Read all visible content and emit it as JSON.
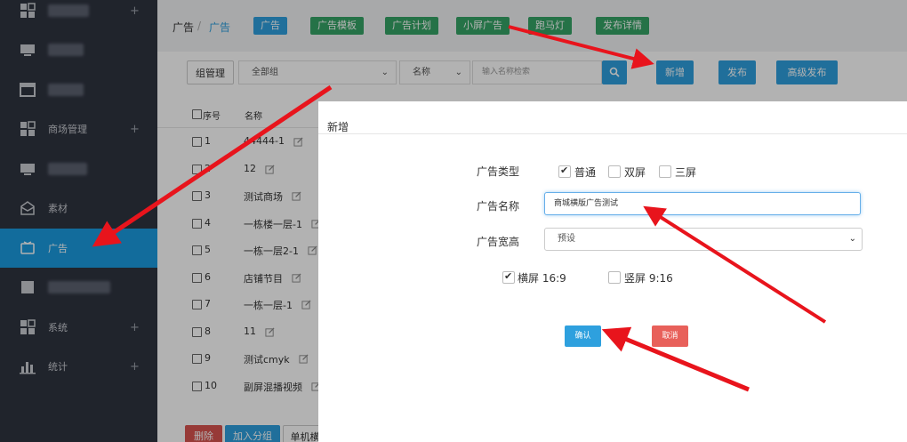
{
  "sidebar": {
    "items": [
      {
        "label": "",
        "icon": "grid-icon",
        "plus": "+",
        "blurred": true
      },
      {
        "label": "",
        "icon": "monitor-icon",
        "plus": "",
        "blurred": true
      },
      {
        "label": "",
        "icon": "window-icon",
        "plus": "",
        "blurred": true
      },
      {
        "label": "商场管理",
        "icon": "grid-icon",
        "plus": "+",
        "blurred": false
      },
      {
        "label": "",
        "icon": "monitor-icon",
        "plus": "",
        "blurred": true
      },
      {
        "label": "素材",
        "icon": "envelope-icon",
        "plus": "",
        "blurred": false
      },
      {
        "label": "广告",
        "icon": "screen-icon",
        "plus": "",
        "blurred": false,
        "active": true
      },
      {
        "label": "",
        "icon": "square-icon",
        "plus": "",
        "blurred": true
      },
      {
        "label": "系统",
        "icon": "grid-icon",
        "plus": "+",
        "blurred": false
      },
      {
        "label": "统计",
        "icon": "bar-chart-icon",
        "plus": "+",
        "blurred": false
      }
    ]
  },
  "breadcrumb": {
    "root": "广告",
    "separator": "/",
    "current": "广告"
  },
  "tabs": [
    {
      "label": "广告",
      "color": "#2ea0de"
    },
    {
      "label": "广告模板",
      "color": "#35a466"
    },
    {
      "label": "广告计划",
      "color": "#35a466"
    },
    {
      "label": "小屏广告",
      "color": "#35a466"
    },
    {
      "label": "跑马灯",
      "color": "#35a466"
    },
    {
      "label": "发布详情",
      "color": "#35a466"
    }
  ],
  "toolbar": {
    "group_manage": "组管理",
    "group_select": "全部组",
    "field_select": "名称",
    "search_placeholder": "输入名称检索",
    "add": "新增",
    "publish": "发布",
    "advanced_publish": "高级发布"
  },
  "table": {
    "headers": {
      "index": "序号",
      "name": "名称"
    },
    "rows": [
      {
        "index": "1",
        "name": "44444-1"
      },
      {
        "index": "2",
        "name": "12"
      },
      {
        "index": "3",
        "name": "测试商场"
      },
      {
        "index": "4",
        "name": "一栋楼一层-1"
      },
      {
        "index": "5",
        "name": "一栋一层2-1"
      },
      {
        "index": "6",
        "name": "店铺节目"
      },
      {
        "index": "7",
        "name": "一栋一层-1"
      },
      {
        "index": "8",
        "name": "11"
      },
      {
        "index": "9",
        "name": "测试cmyk"
      },
      {
        "index": "10",
        "name": "副屏混播视频"
      }
    ]
  },
  "bottom_bar": {
    "delete": "删除",
    "add_group": "加入分组",
    "single": "单机横"
  },
  "modal": {
    "title": "新增",
    "type_label": "广告类型",
    "type_options": [
      {
        "label": "普通",
        "checked": true
      },
      {
        "label": "双屏",
        "checked": false
      },
      {
        "label": "三屏",
        "checked": false
      }
    ],
    "name_label": "广告名称",
    "name_value": "商城横版广告测试",
    "size_label": "广告宽高",
    "size_value": "预设",
    "orientation_options": [
      {
        "label": "横屏 16:9",
        "checked": true
      },
      {
        "label": "竖屏 9:16",
        "checked": false
      }
    ],
    "confirm": "确认",
    "cancel": "取消"
  },
  "colors": {
    "sidebar_bg": "#2f3440",
    "active_blue": "#1a9be0",
    "primary_blue": "#2ea0de",
    "tab_green": "#35a466",
    "cancel_red": "#e8605a",
    "delete_red": "#d9534f",
    "annotation_arrow": "#e8141c"
  }
}
